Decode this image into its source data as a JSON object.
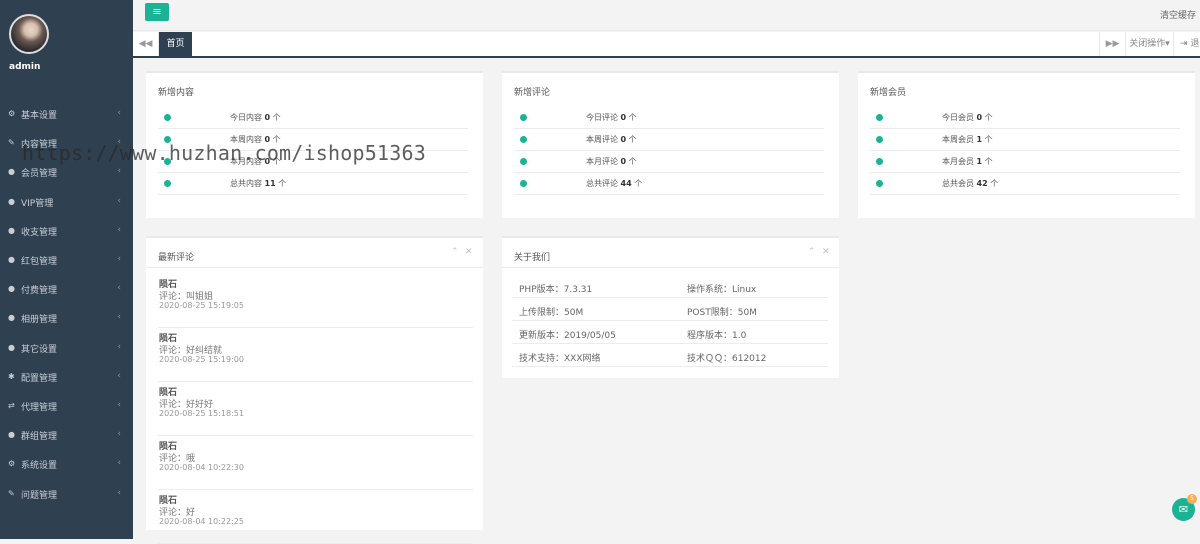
{
  "sidebar": {
    "username": "admin",
    "items": [
      {
        "icon": "gear-icon",
        "glyph": "⚙",
        "label": "基本设置"
      },
      {
        "icon": "edit-icon",
        "glyph": "✎",
        "label": "内容管理"
      },
      {
        "icon": "user-icon",
        "glyph": "●",
        "label": "会员管理"
      },
      {
        "icon": "user-icon",
        "glyph": "●",
        "label": "VIP管理"
      },
      {
        "icon": "user-icon",
        "glyph": "●",
        "label": "收支管理"
      },
      {
        "icon": "user-icon",
        "glyph": "●",
        "label": "红包管理"
      },
      {
        "icon": "user-icon",
        "glyph": "●",
        "label": "付费管理"
      },
      {
        "icon": "user-icon",
        "glyph": "●",
        "label": "相册管理"
      },
      {
        "icon": "user-icon",
        "glyph": "●",
        "label": "其它设置"
      },
      {
        "icon": "asterisk-icon",
        "glyph": "✱",
        "label": "配置管理"
      },
      {
        "icon": "exchange-icon",
        "glyph": "⇄",
        "label": "代理管理"
      },
      {
        "icon": "user-icon",
        "glyph": "●",
        "label": "群组管理"
      },
      {
        "icon": "cogs-icon",
        "glyph": "⚙",
        "label": "系统设置"
      },
      {
        "icon": "edit-icon",
        "glyph": "✎",
        "label": "问题管理"
      }
    ]
  },
  "topbar": {
    "menu_glyph": "≡",
    "clear_cache": "清空缓存"
  },
  "tabs": {
    "prev_glyph": "◀◀",
    "home": "首页",
    "next_glyph": "▶▶",
    "close_ops": "关闭操作▾",
    "exit": "⇥ 退"
  },
  "stats": [
    {
      "title": "新增内容",
      "rows": [
        {
          "label": "今日内容",
          "value": "0",
          "unit": "个"
        },
        {
          "label": "本周内容",
          "value": "0",
          "unit": "个"
        },
        {
          "label": "本月内容",
          "value": "0",
          "unit": "个"
        },
        {
          "label": "总共内容",
          "value": "11",
          "unit": "个"
        }
      ]
    },
    {
      "title": "新增评论",
      "rows": [
        {
          "label": "今日评论",
          "value": "0",
          "unit": "个"
        },
        {
          "label": "本周评论",
          "value": "0",
          "unit": "个"
        },
        {
          "label": "本月评论",
          "value": "0",
          "unit": "个"
        },
        {
          "label": "总共评论",
          "value": "44",
          "unit": "个"
        }
      ]
    },
    {
      "title": "新增会员",
      "rows": [
        {
          "label": "今日会员",
          "value": "0",
          "unit": "个"
        },
        {
          "label": "本周会员",
          "value": "1",
          "unit": "个"
        },
        {
          "label": "本月会员",
          "value": "1",
          "unit": "个"
        },
        {
          "label": "总共会员",
          "value": "42",
          "unit": "个"
        }
      ]
    }
  ],
  "comments": {
    "title": "最新评论",
    "collapse_glyph": "⌃",
    "close_glyph": "✕",
    "items": [
      {
        "name": "陨石",
        "text": "评论：叫姐姐",
        "date": "2020-08-25 15:19:05"
      },
      {
        "name": "陨石",
        "text": "评论：好纠结就",
        "date": "2020-08-25 15:19:00"
      },
      {
        "name": "陨石",
        "text": "评论：好好好",
        "date": "2020-08-25 15:18:51"
      },
      {
        "name": "陨石",
        "text": "评论：哦",
        "date": "2020-08-04 10:22:30"
      },
      {
        "name": "陨石",
        "text": "评论：好",
        "date": "2020-08-04 10:22:25"
      }
    ]
  },
  "about": {
    "title": "关于我们",
    "collapse_glyph": "⌃",
    "close_glyph": "✕",
    "rows": [
      {
        "left": "PHP版本：7.3.31",
        "right": "操作系统：Linux"
      },
      {
        "left": "上传限制：50M",
        "right": "POST限制：50M"
      },
      {
        "left": "更新版本：2019/05/05",
        "right": "程序版本：1.0"
      },
      {
        "left": "技术支持：XXX网络",
        "right": "技术ＱＱ：612012"
      }
    ]
  },
  "chat": {
    "glyph": "✉",
    "badge": "5"
  },
  "watermark": "https://www.huzhan.com/ishop51363",
  "colors": {
    "accent": "#1ab394",
    "sidebar": "#2f4050",
    "badge": "#f8ac59"
  }
}
